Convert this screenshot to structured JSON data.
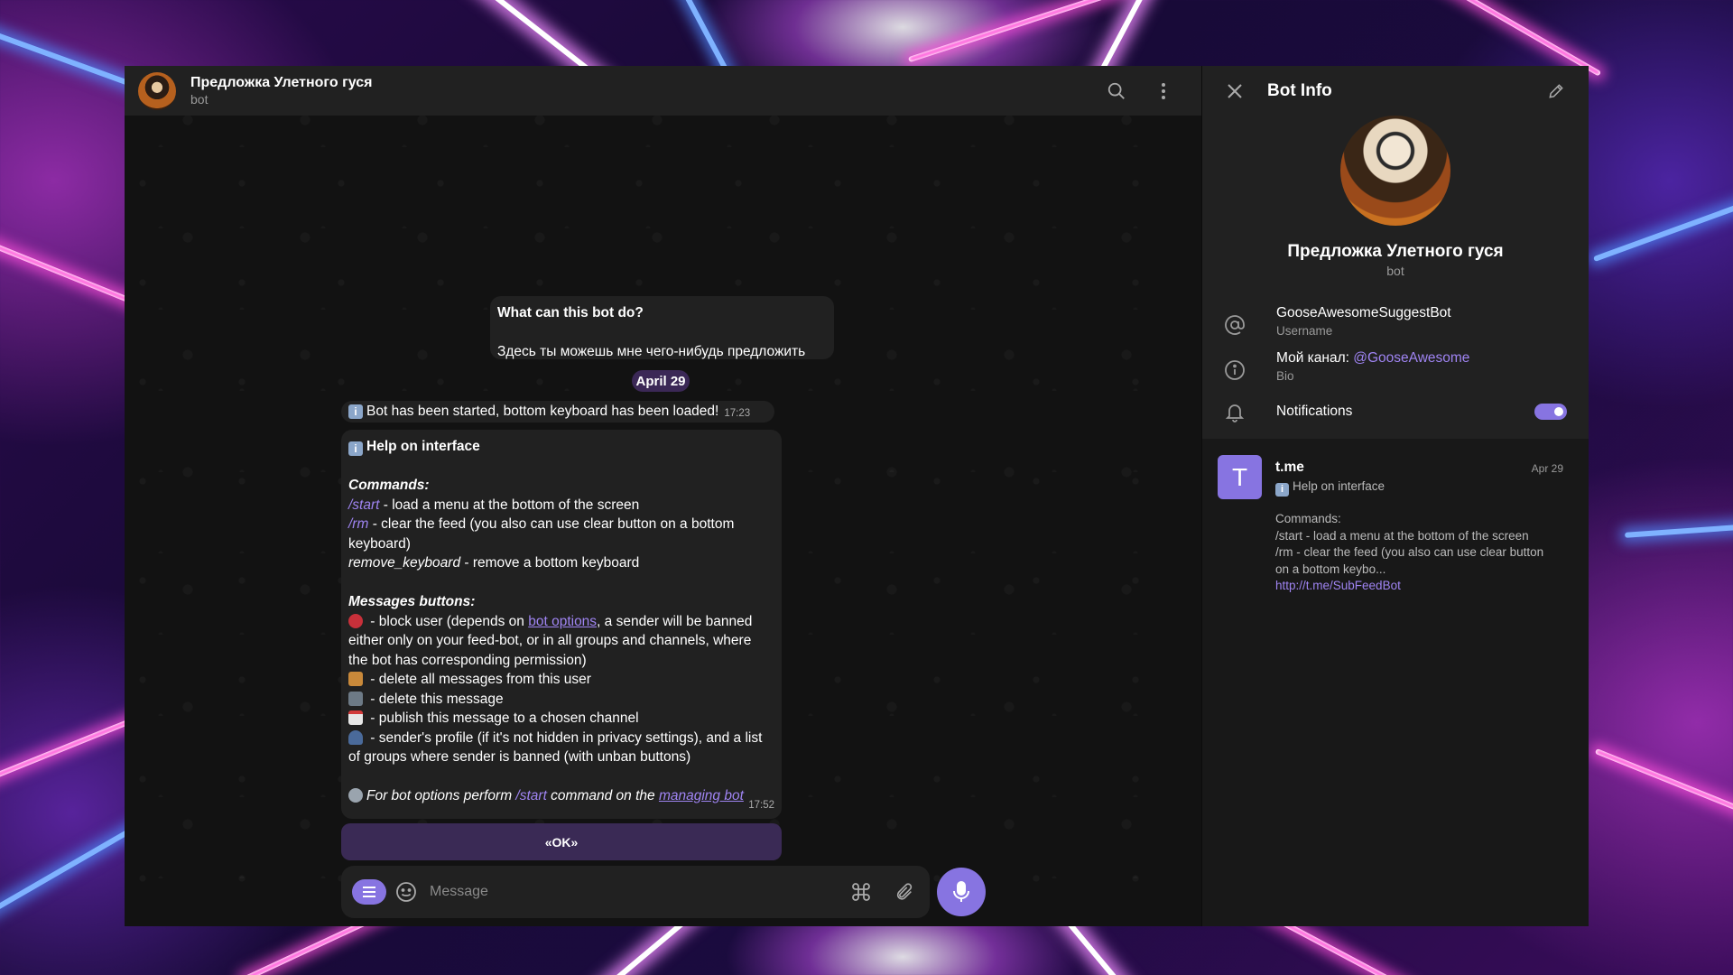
{
  "header": {
    "title": "Предложка Улетного гуся",
    "subtitle": "bot"
  },
  "intro": {
    "title": "What can this bot do?",
    "text": "Здесь ты можешь мне чего-нибудь предложить"
  },
  "date_label": "April 29",
  "messages": [
    {
      "text": "Bot has been started, bottom keyboard has been loaded!",
      "time": "17:23"
    }
  ],
  "help": {
    "title": "Help on interface",
    "commands_heading": "Commands:",
    "commands": [
      {
        "cmd": "/start",
        "desc": " - load a menu at the bottom of the screen"
      },
      {
        "cmd": "/rm",
        "desc": " - clear the feed (you also can use clear button on a bottom keyboard)"
      },
      {
        "cmd": "remove_keyboard",
        "desc": " - remove a bottom keyboard"
      }
    ],
    "buttons_heading": "Messages buttons:",
    "block_pre": " - block user (depends on ",
    "block_link": "bot options",
    "block_post": ", a sender will be banned either only on your feed-bot, or in all groups and channels, where the bot has corresponding permission)",
    "buttons": [
      " - delete all messages from this user",
      " - delete this message",
      " - publish this message to a chosen channel",
      " - sender's profile (if it's not hidden in privacy settings), and a list of groups where sender is banned (with unban buttons)"
    ],
    "footer_pre": "For bot options perform ",
    "footer_cmd": "/start",
    "footer_mid": " command on the ",
    "footer_link": "managing bot",
    "time": "17:52"
  },
  "keyboard_button": "«OK»",
  "composer": {
    "placeholder": "Message"
  },
  "panel": {
    "title": "Bot Info",
    "name": "Предложка Улетного гуся",
    "subtitle": "bot",
    "username": "GooseAwesomeSuggestBot",
    "username_label": "Username",
    "bio_prefix": "Мой канал: ",
    "bio_link": "@GooseAwesome",
    "bio_label": "Bio",
    "notifications_label": "Notifications",
    "notifications_on": true
  },
  "preview": {
    "letter": "T",
    "title": "t.me",
    "date": "Apr 29",
    "subtitle": "Help on interface",
    "body_lines": [
      "Commands:",
      "/start - load a menu at the bottom of the screen",
      "/rm - clear the feed (you also can use clear button",
      "on a bottom keybo..."
    ],
    "link": "http://t.me/SubFeedBot"
  },
  "colors": {
    "accent": "#8774e1",
    "link": "#9f84f2",
    "bubble": "#212121",
    "date_pill": "#3b2856"
  }
}
